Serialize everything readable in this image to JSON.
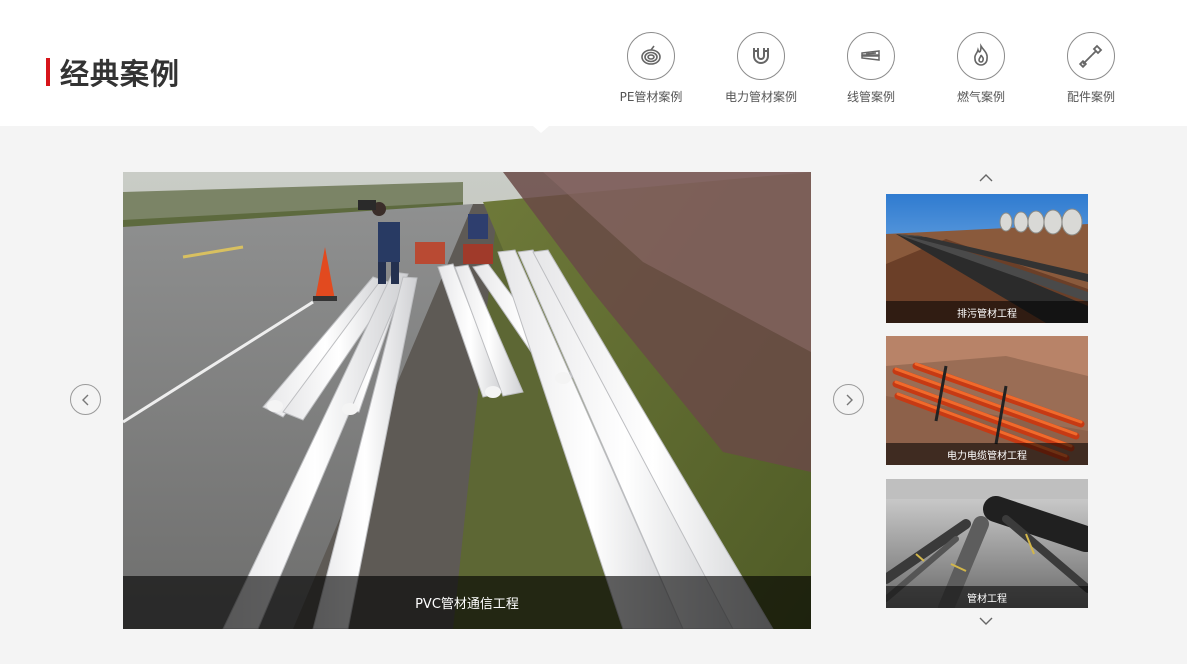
{
  "header": {
    "title": "经典案例"
  },
  "categories": [
    {
      "label": "PE管材案例",
      "icon": "coiled-pipe-icon"
    },
    {
      "label": "电力管材案例",
      "icon": "magnet-icon"
    },
    {
      "label": "线管案例",
      "icon": "conduit-icon"
    },
    {
      "label": "燃气案例",
      "icon": "flame-icon"
    },
    {
      "label": "配件案例",
      "icon": "wrench-icon"
    }
  ],
  "main_slide": {
    "caption": "PVC管材通信工程"
  },
  "thumbnails": [
    {
      "caption": "排污管材工程"
    },
    {
      "caption": "电力电缆管材工程"
    },
    {
      "caption": "管材工程"
    }
  ],
  "colors": {
    "accent": "#d7141a",
    "background": "#f4f4f4",
    "header_bg": "#ffffff"
  }
}
